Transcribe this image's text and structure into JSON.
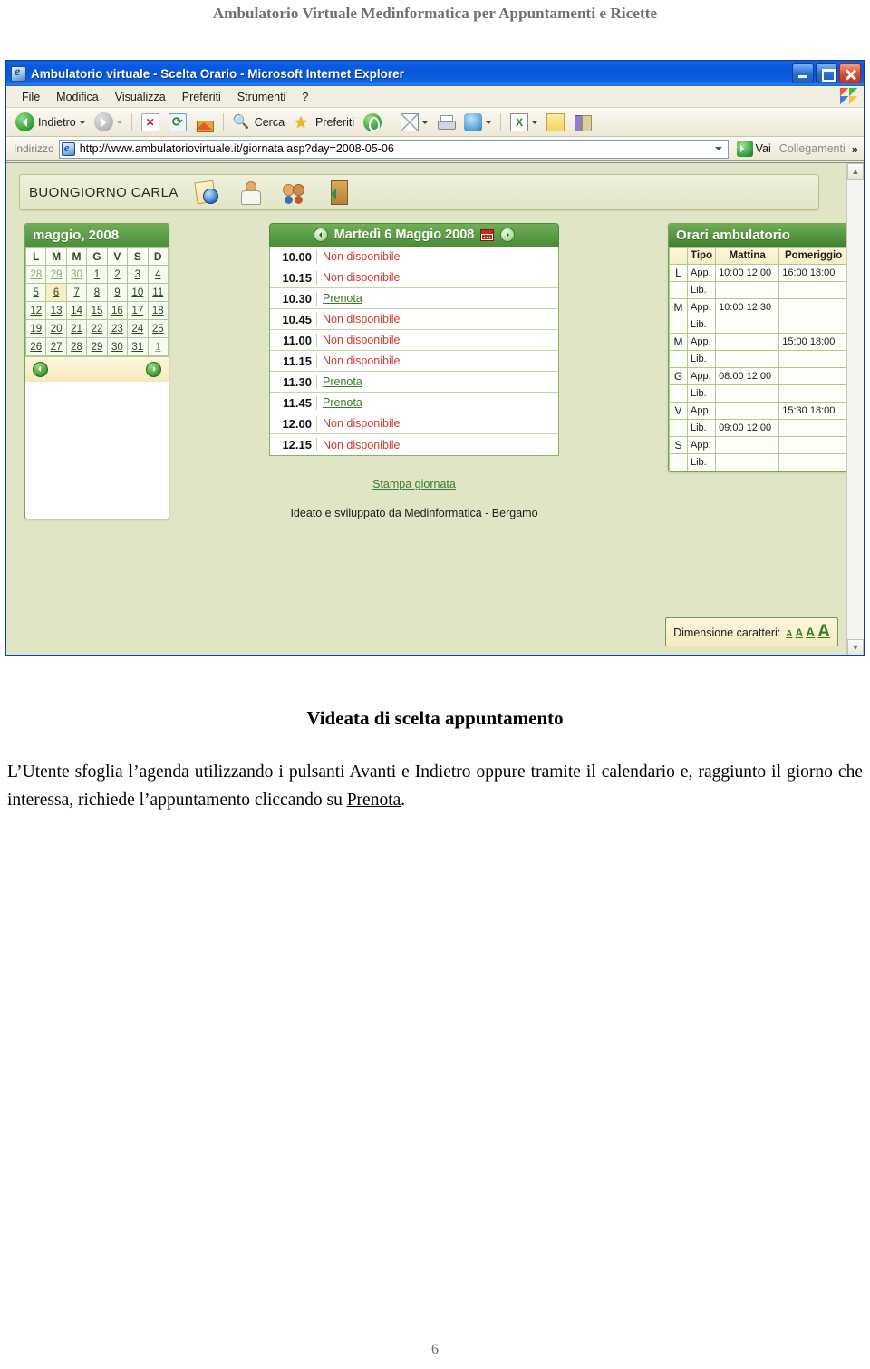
{
  "document": {
    "header": "Ambulatorio Virtuale Medinformatica per Appuntamenti e Ricette",
    "caption_title": "Videata di scelta appuntamento",
    "caption_body_1": "L’Utente sfoglia  l’agenda utilizzando i pulsanti Avanti e Indietro oppure tramite il calendario e, raggiunto il giorno che interessa, richiede l’appuntamento cliccando su ",
    "caption_link": "Prenota",
    "caption_body_2": ".",
    "page_number": "6"
  },
  "browser": {
    "window_title": "Ambulatorio virtuale - Scelta Orario - Microsoft Internet Explorer",
    "menu": [
      "File",
      "Modifica",
      "Visualizza",
      "Preferiti",
      "Strumenti",
      "?"
    ],
    "toolbar": {
      "back": "Indietro",
      "search": "Cerca",
      "favorites": "Preferiti"
    },
    "address": {
      "label": "Indirizzo",
      "url": "http://www.ambulatoriovirtuale.it/giornata.asp?day=2008-05-06",
      "go": "Vai",
      "links": "Collegamenti",
      "chevron": "»"
    }
  },
  "page": {
    "greeting": "BUONGIORNO CARLA",
    "calendar": {
      "title": "maggio, 2008",
      "weekdays": [
        "L",
        "M",
        "M",
        "G",
        "V",
        "S",
        "D"
      ],
      "weeks": [
        [
          {
            "d": "28",
            "other": true
          },
          {
            "d": "29",
            "other": true
          },
          {
            "d": "30",
            "other": true
          },
          {
            "d": "1"
          },
          {
            "d": "2"
          },
          {
            "d": "3"
          },
          {
            "d": "4"
          }
        ],
        [
          {
            "d": "5"
          },
          {
            "d": "6",
            "selected": true
          },
          {
            "d": "7"
          },
          {
            "d": "8"
          },
          {
            "d": "9"
          },
          {
            "d": "10"
          },
          {
            "d": "11"
          }
        ],
        [
          {
            "d": "12"
          },
          {
            "d": "13"
          },
          {
            "d": "14"
          },
          {
            "d": "15"
          },
          {
            "d": "16"
          },
          {
            "d": "17"
          },
          {
            "d": "18"
          }
        ],
        [
          {
            "d": "19"
          },
          {
            "d": "20"
          },
          {
            "d": "21"
          },
          {
            "d": "22"
          },
          {
            "d": "23"
          },
          {
            "d": "24"
          },
          {
            "d": "25"
          }
        ],
        [
          {
            "d": "26"
          },
          {
            "d": "27"
          },
          {
            "d": "28"
          },
          {
            "d": "29"
          },
          {
            "d": "30"
          },
          {
            "d": "31"
          },
          {
            "d": "1",
            "other": true
          }
        ]
      ]
    },
    "day": {
      "title": "Martedì 6 Maggio 2008",
      "slots": [
        {
          "time": "10.00",
          "status": "Non disponibile",
          "available": false
        },
        {
          "time": "10.15",
          "status": "Non disponibile",
          "available": false
        },
        {
          "time": "10.30",
          "status": "Prenota",
          "available": true
        },
        {
          "time": "10.45",
          "status": "Non disponibile",
          "available": false
        },
        {
          "time": "11.00",
          "status": "Non disponibile",
          "available": false
        },
        {
          "time": "11.15",
          "status": "Non disponibile",
          "available": false
        },
        {
          "time": "11.30",
          "status": "Prenota",
          "available": true
        },
        {
          "time": "11.45",
          "status": "Prenota",
          "available": true
        },
        {
          "time": "12.00",
          "status": "Non disponibile",
          "available": false
        },
        {
          "time": "12.15",
          "status": "Non disponibile",
          "available": false
        }
      ],
      "print_link": "Stampa giornata",
      "credits": "Ideato e sviluppato da Medinformatica - Bergamo"
    },
    "orari": {
      "title": "Orari ambulatorio",
      "headers": [
        "",
        "Tipo",
        "Mattina",
        "Pomeriggio"
      ],
      "rows": [
        {
          "day": "L",
          "tipo": "App.",
          "mattina": "10:00 12:00",
          "pomeriggio": "16:00 18:00"
        },
        {
          "day": "",
          "tipo": "Lib.",
          "mattina": "",
          "pomeriggio": ""
        },
        {
          "day": "M",
          "tipo": "App.",
          "mattina": "10:00 12:30",
          "pomeriggio": ""
        },
        {
          "day": "",
          "tipo": "Lib.",
          "mattina": "",
          "pomeriggio": ""
        },
        {
          "day": "M",
          "tipo": "App.",
          "mattina": "",
          "pomeriggio": "15:00 18:00"
        },
        {
          "day": "",
          "tipo": "Lib.",
          "mattina": "",
          "pomeriggio": ""
        },
        {
          "day": "G",
          "tipo": "App.",
          "mattina": "08:00 12:00",
          "pomeriggio": ""
        },
        {
          "day": "",
          "tipo": "Lib.",
          "mattina": "",
          "pomeriggio": ""
        },
        {
          "day": "V",
          "tipo": "App.",
          "mattina": "",
          "pomeriggio": "15:30 18:00"
        },
        {
          "day": "",
          "tipo": "Lib.",
          "mattina": "09:00 12:00",
          "pomeriggio": ""
        },
        {
          "day": "S",
          "tipo": "App.",
          "mattina": "",
          "pomeriggio": ""
        },
        {
          "day": "",
          "tipo": "Lib.",
          "mattina": "",
          "pomeriggio": ""
        }
      ]
    },
    "fontsize": {
      "label": "Dimensione caratteri:",
      "options": [
        "A",
        "A",
        "A",
        "A"
      ]
    },
    "colors": {
      "page_background": "#dfe5c5",
      "header_green": "#4e8f3c",
      "unavailable_red": "#cf3b2f",
      "link_green": "#3d7a2e",
      "selected_day": "#fbeec6"
    }
  }
}
